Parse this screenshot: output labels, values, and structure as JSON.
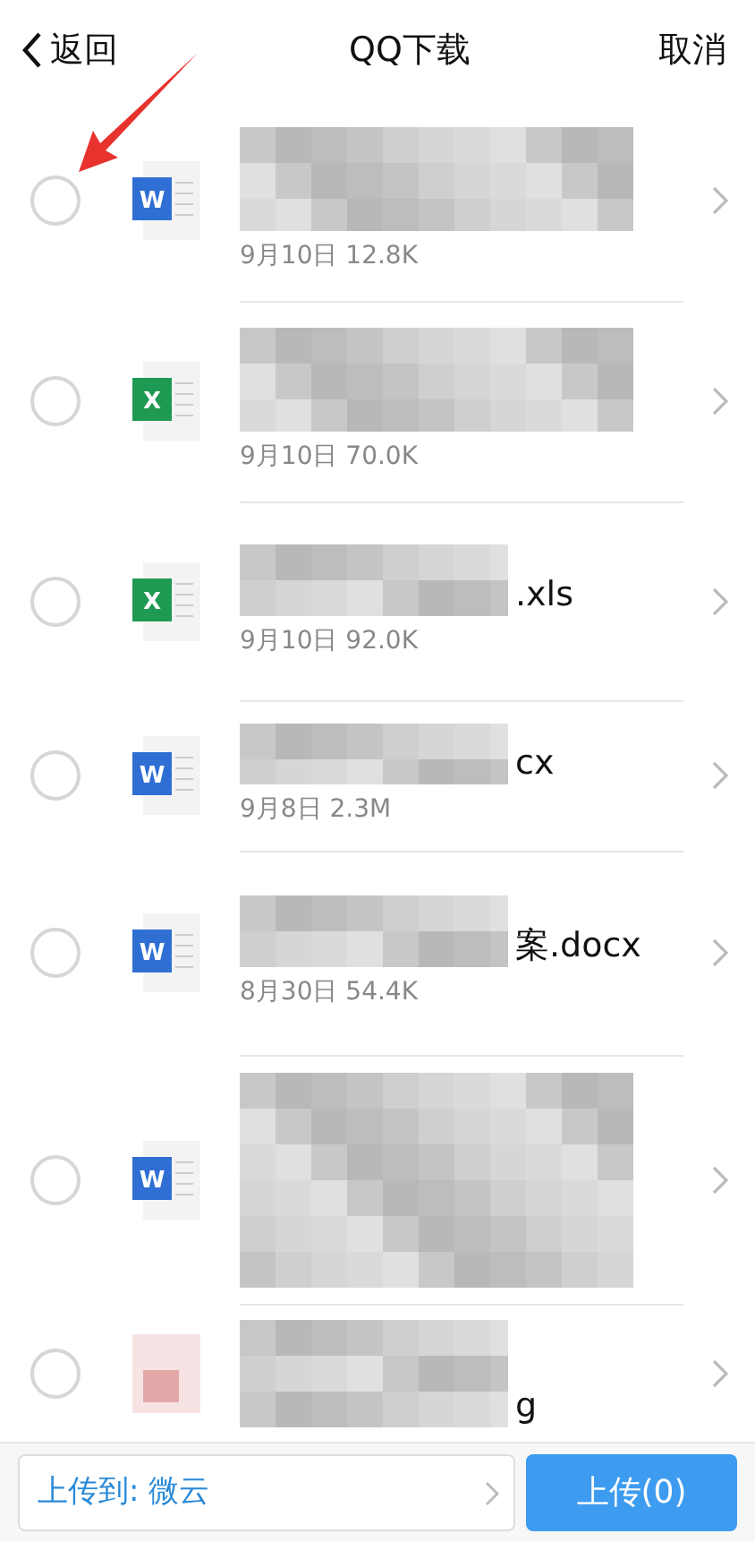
{
  "header": {
    "back": "返回",
    "title": "QQ下载",
    "cancel": "取消"
  },
  "files": [
    {
      "kind": "word",
      "icon_letter": "W",
      "meta": "9月10日 12.8K",
      "selected": false
    },
    {
      "kind": "excel",
      "icon_letter": "X",
      "meta": "9月10日 70.0K",
      "selected": false
    },
    {
      "kind": "excel",
      "icon_letter": "X",
      "name_visible": ".xls",
      "meta": "9月10日 92.0K",
      "selected": false
    },
    {
      "kind": "word",
      "icon_letter": "W",
      "name_visible": "cx",
      "meta": "9月8日 2.3M",
      "selected": false
    },
    {
      "kind": "word",
      "icon_letter": "W",
      "name_visible": "案.docx",
      "meta": "8月30日 54.4K",
      "selected": false
    },
    {
      "kind": "word",
      "icon_letter": "W",
      "selected": false
    },
    {
      "kind": "image",
      "name_visible": "g",
      "selected": false
    }
  ],
  "bottom_bar": {
    "destination": "上传到: 微云",
    "upload": "上传(0)"
  }
}
